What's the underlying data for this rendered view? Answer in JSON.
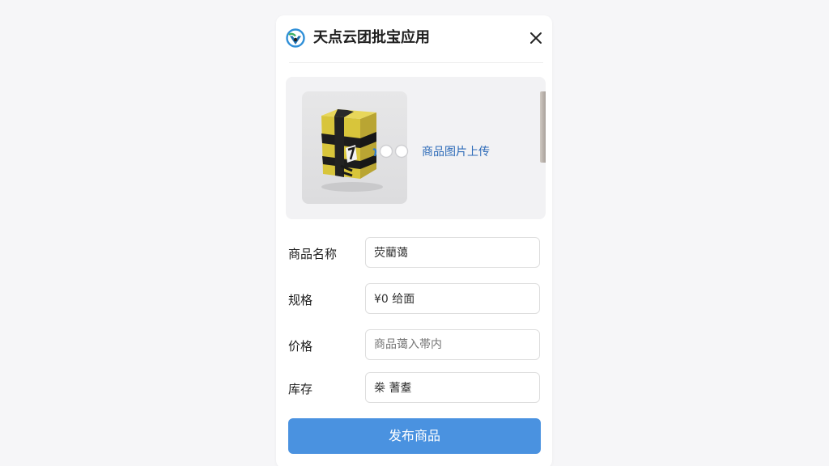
{
  "app": {
    "title": "天点云团批宝应用"
  },
  "upload": {
    "link_text": "商品图片上传"
  },
  "form": {
    "name_label": "商品名称",
    "name_value": "荧藺蔼",
    "spec_label": "规格",
    "spec_value": "¥0 给面",
    "price_label": "价格",
    "price_placeholder": "商品蔼入帯内",
    "stock_label": "库存",
    "stock_value": "桊 蓍耋"
  },
  "actions": {
    "publish_label": "发布商品"
  },
  "colors": {
    "primary": "#4a92e0",
    "link": "#2d6bb8",
    "background": "#f6f6f8",
    "card": "#ffffff"
  },
  "icons": {
    "logo": "tiandian-logo-icon",
    "close": "close-icon"
  }
}
